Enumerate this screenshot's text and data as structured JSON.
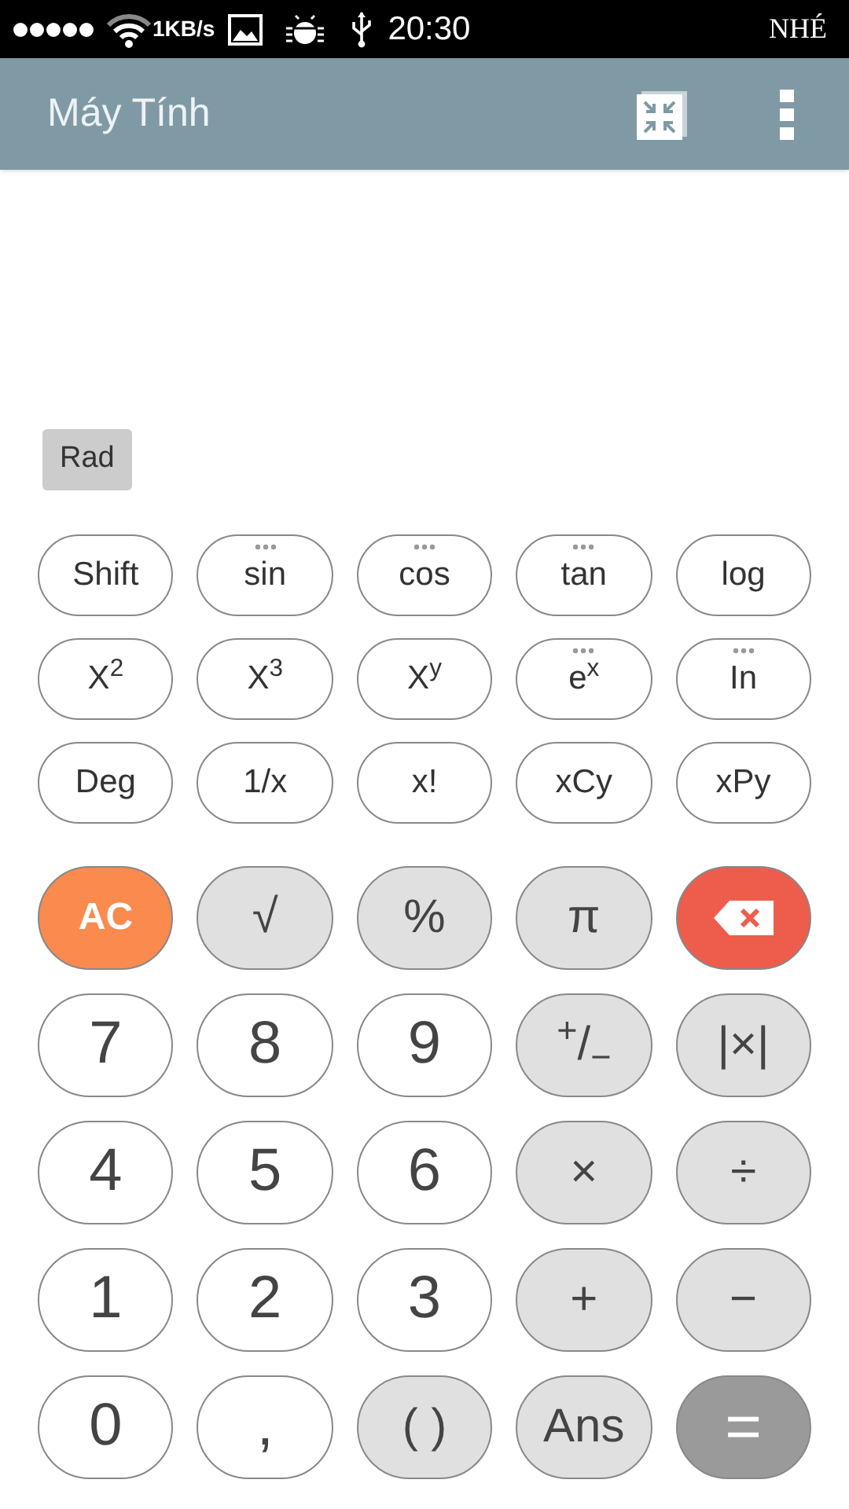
{
  "status_bar": {
    "speed": "1KB/s",
    "time": "20:30",
    "carrier": "NHÉ"
  },
  "app_bar": {
    "title": "Máy Tính"
  },
  "mode_badge": "Rad",
  "function_keys": [
    {
      "label": "Shift",
      "more": false
    },
    {
      "label": "sin",
      "more": true
    },
    {
      "label": "cos",
      "more": true
    },
    {
      "label": "tan",
      "more": true
    },
    {
      "label": "log",
      "more": false
    },
    {
      "label": "X$^{2}$",
      "more": false
    },
    {
      "label": "X$^{3}$",
      "more": false
    },
    {
      "label": "X$^{y}$",
      "more": false
    },
    {
      "label": "e$^{x}$",
      "more": true
    },
    {
      "label": "In",
      "more": true
    },
    {
      "label": "Deg",
      "more": false
    },
    {
      "label": "1/x",
      "more": false
    },
    {
      "label": "x!",
      "more": false
    },
    {
      "label": "xCy",
      "more": false
    },
    {
      "label": "xPy",
      "more": false
    }
  ],
  "main_keys": [
    {
      "label": "AC",
      "kind": "clear"
    },
    {
      "label": "√",
      "kind": "op"
    },
    {
      "label": "%",
      "kind": "op"
    },
    {
      "label": "π",
      "kind": "op"
    },
    {
      "kind": "backspace"
    },
    {
      "label": "7",
      "kind": "digit"
    },
    {
      "label": "8",
      "kind": "digit"
    },
    {
      "label": "9",
      "kind": "digit"
    },
    {
      "label": "$^{+}$/$_{−}$",
      "kind": "op"
    },
    {
      "label": "|×|",
      "kind": "op"
    },
    {
      "label": "4",
      "kind": "digit"
    },
    {
      "label": "5",
      "kind": "digit"
    },
    {
      "label": "6",
      "kind": "digit"
    },
    {
      "label": "×",
      "kind": "op"
    },
    {
      "label": "÷",
      "kind": "op"
    },
    {
      "label": "1",
      "kind": "digit"
    },
    {
      "label": "2",
      "kind": "digit"
    },
    {
      "label": "3",
      "kind": "digit"
    },
    {
      "label": "+",
      "kind": "op"
    },
    {
      "label": "−",
      "kind": "op"
    },
    {
      "label": "0",
      "kind": "digit"
    },
    {
      "label": ",",
      "kind": "digit"
    },
    {
      "label": "( )",
      "kind": "op"
    },
    {
      "label": "Ans",
      "kind": "op"
    },
    {
      "label": "=",
      "kind": "equals"
    }
  ]
}
